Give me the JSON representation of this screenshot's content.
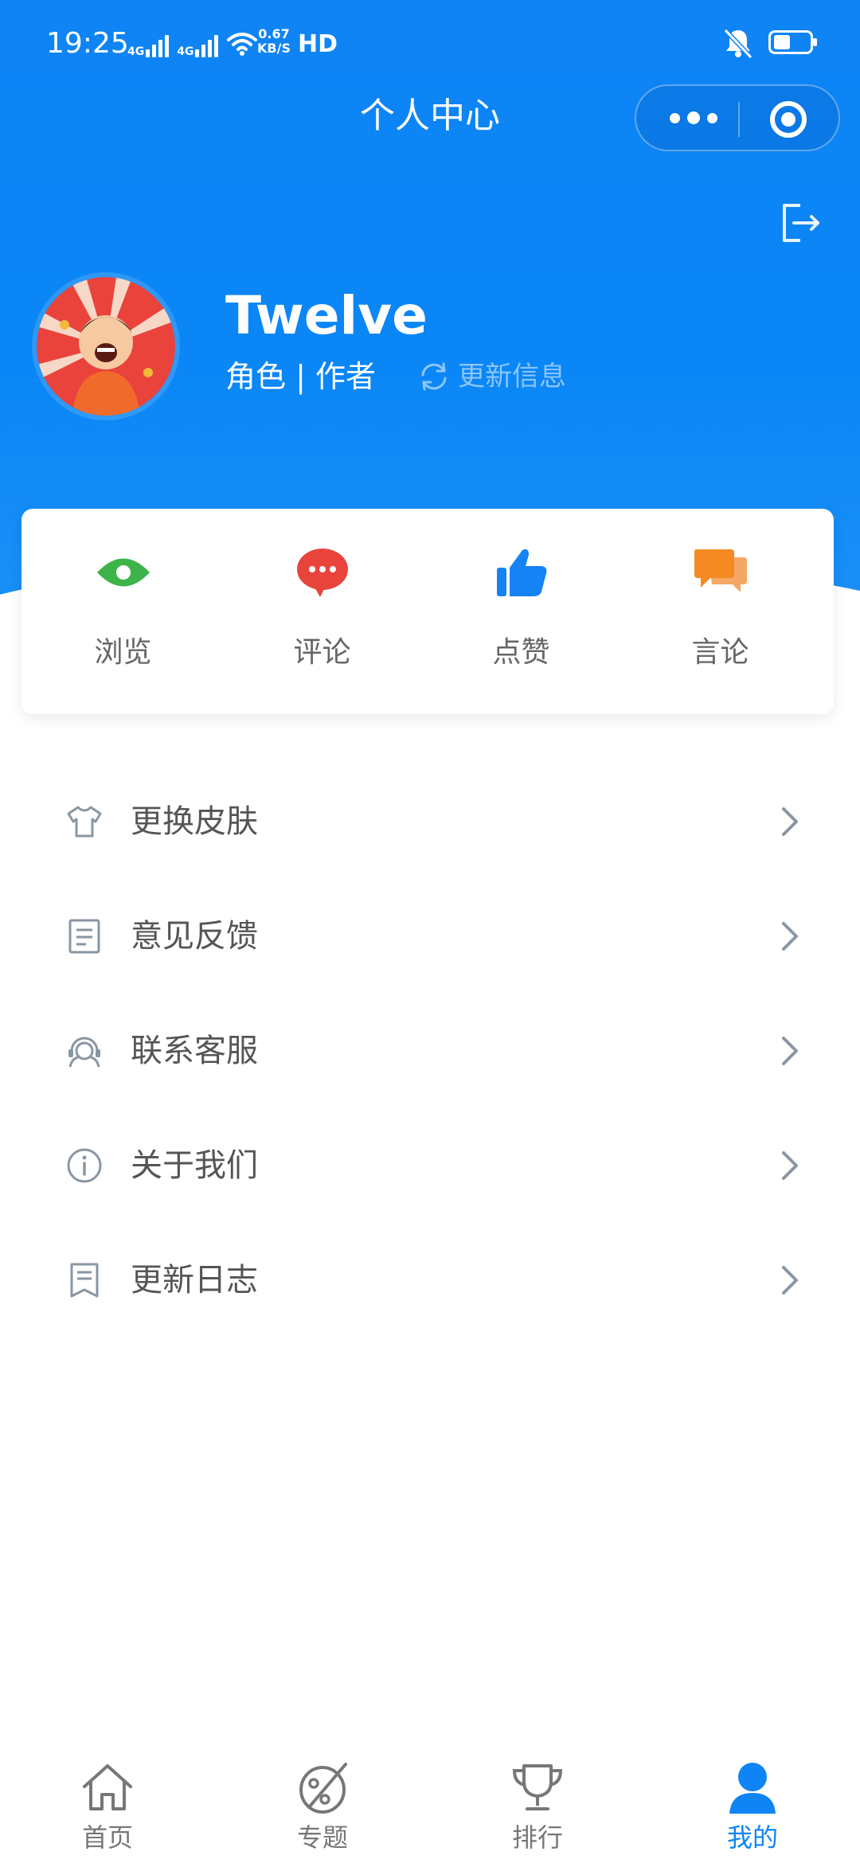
{
  "status_bar": {
    "time": "19:25",
    "net1": "4G",
    "net2": "4G",
    "speed_value": "0.67",
    "speed_unit": "KB/S",
    "hd": "HD"
  },
  "header": {
    "title": "个人中心"
  },
  "profile": {
    "name": "Twelve",
    "role": "角色 | 作者",
    "update_info": "更新信息"
  },
  "stats": [
    {
      "label": "浏览",
      "icon": "eye-icon",
      "color": "#3db34a"
    },
    {
      "label": "评论",
      "icon": "comment-icon",
      "color": "#e8443c"
    },
    {
      "label": "点赞",
      "icon": "thumbs-up-icon",
      "color": "#1583f3"
    },
    {
      "label": "言论",
      "icon": "speech-icon",
      "color": "#f58a22"
    }
  ],
  "menu": [
    {
      "label": "更换皮肤",
      "icon": "shirt-icon"
    },
    {
      "label": "意见反馈",
      "icon": "feedback-icon"
    },
    {
      "label": "联系客服",
      "icon": "support-icon"
    },
    {
      "label": "关于我们",
      "icon": "info-icon"
    },
    {
      "label": "更新日志",
      "icon": "log-icon"
    }
  ],
  "tabs": [
    {
      "label": "首页",
      "icon": "home-icon"
    },
    {
      "label": "专题",
      "icon": "topic-icon"
    },
    {
      "label": "排行",
      "icon": "trophy-icon"
    },
    {
      "label": "我的",
      "icon": "user-icon",
      "active": true
    }
  ],
  "colors": {
    "primary": "#0e84f5",
    "text_secondary": "#555555",
    "chevron": "#8a96a3"
  }
}
